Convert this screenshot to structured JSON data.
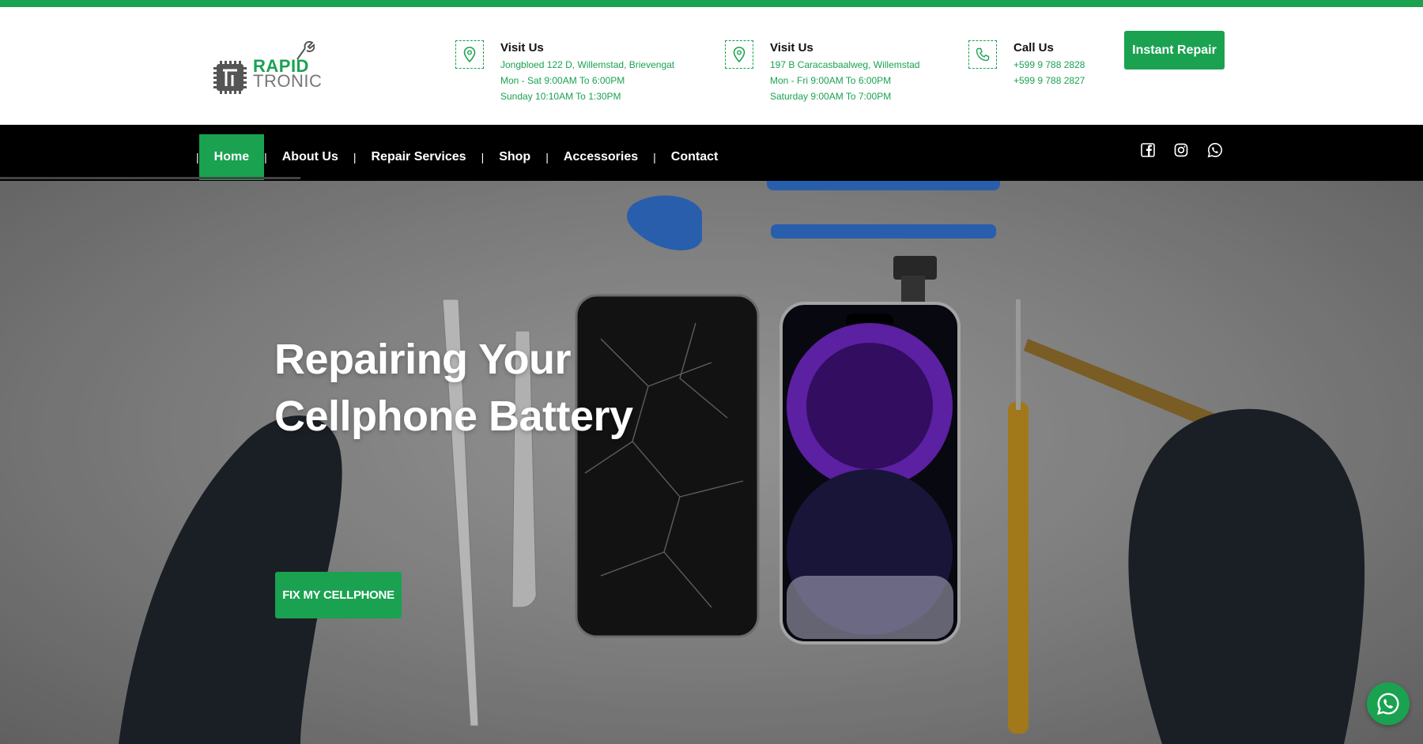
{
  "header": {
    "logo": {
      "line1": "RAPID",
      "line2": "TRONIC"
    },
    "locations": [
      {
        "icon": "map-pin-icon",
        "title": "Visit Us",
        "lines": [
          "Jongbloed 122 D, Willemstad, Brievengat",
          "Mon - Sat 9:00AM To 6:00PM",
          "Sunday 10:10AM To 1:30PM"
        ]
      },
      {
        "icon": "map-pin-icon",
        "title": "Visit Us",
        "lines": [
          "197 B Caracasbaalweg, Willemstad",
          "Mon - Fri 9:00AM To 6:00PM",
          "Saturday 9:00AM To 7:00PM"
        ]
      }
    ],
    "call": {
      "icon": "phone-icon",
      "title": "Call Us",
      "lines": [
        "+599 9 788 2828",
        "+599 9 788 2827"
      ]
    },
    "instant_repair_label": "Instant Repair"
  },
  "nav": {
    "items": [
      {
        "label": "Home",
        "active": true
      },
      {
        "label": "About Us"
      },
      {
        "label": "Repair Services"
      },
      {
        "label": "Shop"
      },
      {
        "label": "Accessories"
      },
      {
        "label": "Contact"
      }
    ],
    "separator": "|",
    "social_icons": [
      "facebook-icon",
      "instagram-icon",
      "whatsapp-icon"
    ]
  },
  "hero": {
    "title_line1": "Repairing Your",
    "title_line2": "Cellphone Battery",
    "cta_label": "FIX MY CELLPHONE"
  },
  "floating": {
    "icon": "whatsapp-icon"
  },
  "colors": {
    "accent": "#1aa250",
    "nav_bg": "#000000",
    "text_dark": "#111111"
  }
}
